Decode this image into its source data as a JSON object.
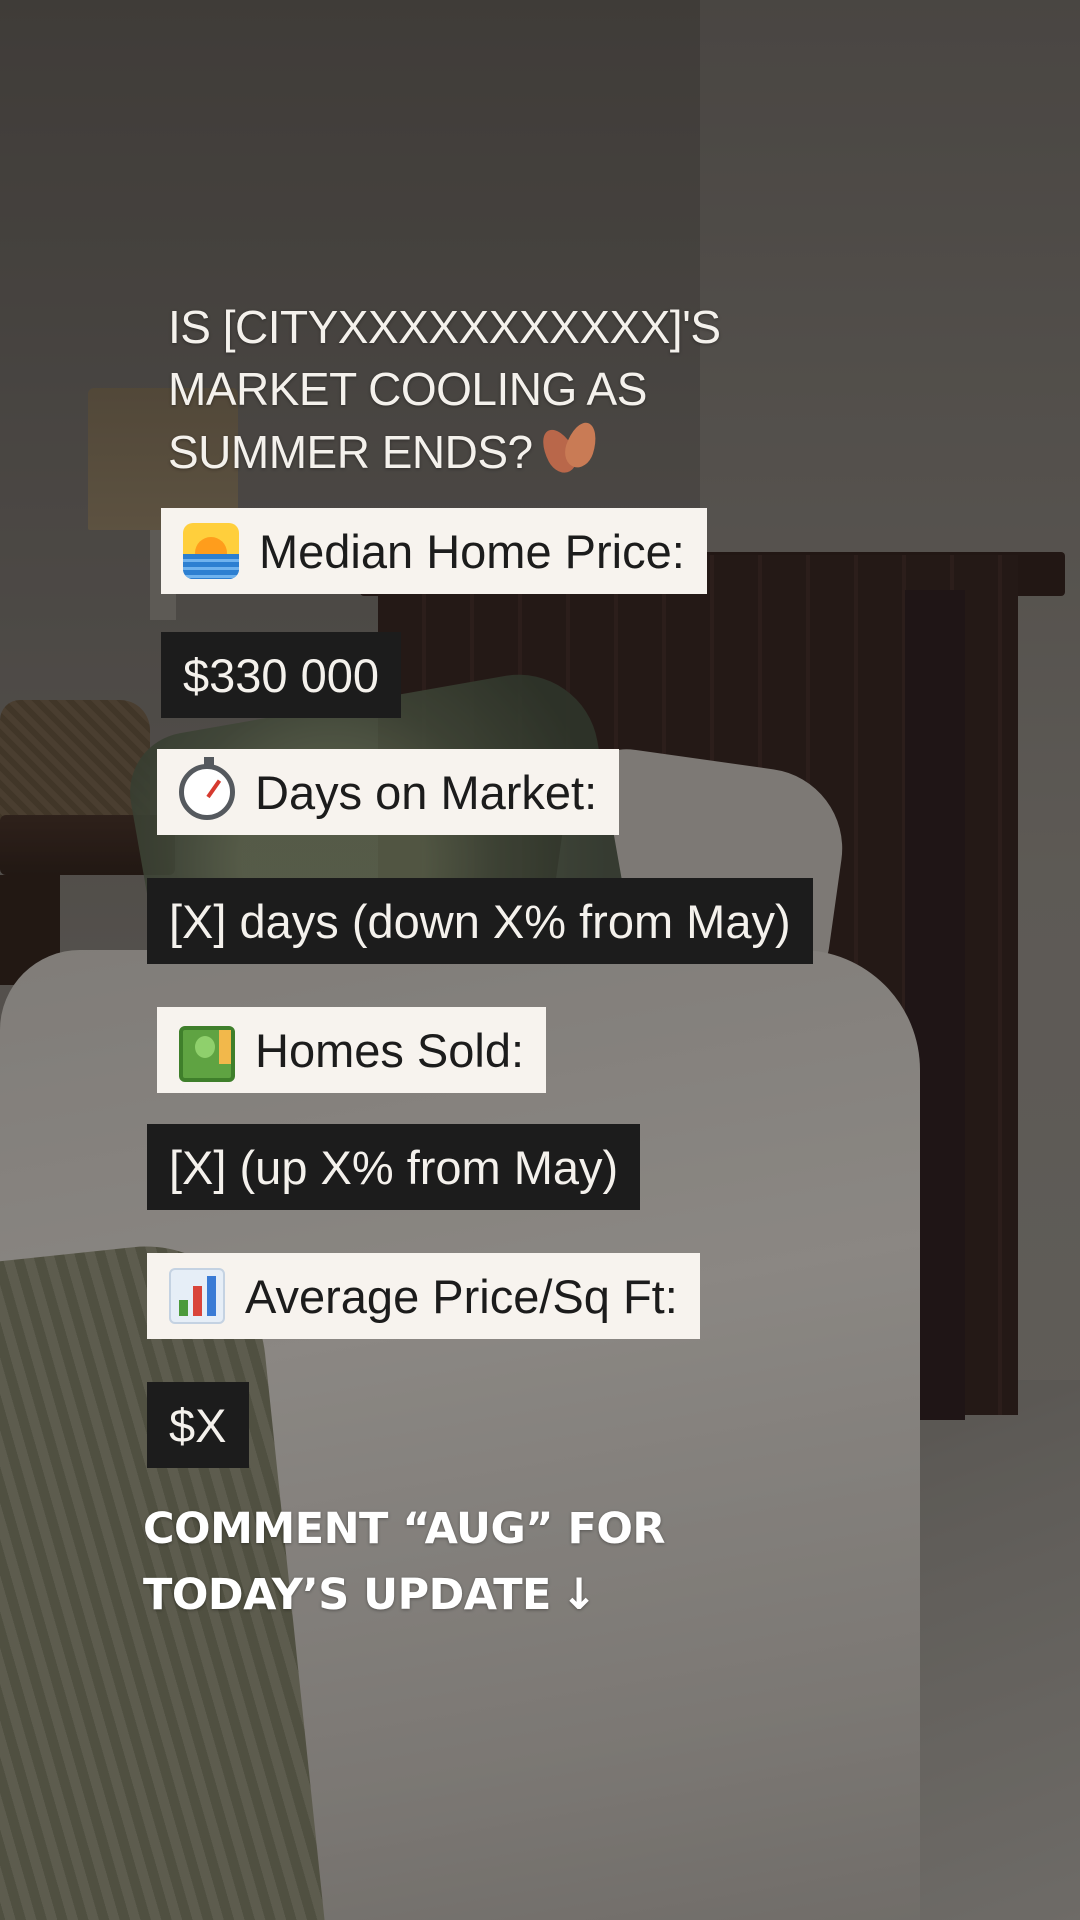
{
  "headline": {
    "line1": "IS [CITYXXXXXXXXXXX]'S",
    "line2": "MARKET COOLING AS",
    "line3": "SUMMER ENDS?",
    "icon": "fallen-leaves-icon"
  },
  "stats": [
    {
      "label": "Median Home Price:",
      "icon": "sunrise-icon",
      "value": "$330 000"
    },
    {
      "label": "Days on Market:",
      "icon": "stopwatch-icon",
      "value": "[X] days (down X% from  May)"
    },
    {
      "label": "Homes Sold:",
      "icon": "money-icon",
      "value": "[X] (up X% from May)"
    },
    {
      "label": "Average Price/Sq Ft:",
      "icon": "bar-chart-icon",
      "value": "$X"
    }
  ],
  "cta": {
    "line1": "COMMENT “AUG” FOR",
    "line2": "TODAY’S UPDATE",
    "arrow": "↓"
  },
  "colors": {
    "light_chip": "#f7f3ee",
    "dark_chip": "#1c1c1c",
    "text_light": "#f4f1ec"
  }
}
